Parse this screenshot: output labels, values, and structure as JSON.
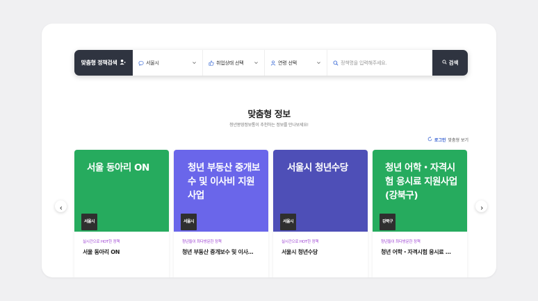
{
  "search": {
    "title": "맞춤형 정책검색",
    "region": "서울시",
    "job_status": "취업상태 선택",
    "age": "연령 선택",
    "placeholder": "정책명을 입력해주세요.",
    "button": "검색"
  },
  "section": {
    "title": "맞춤형 정보",
    "subtitle": "청년몽땅정보통이 추천하는 정보를 만나보세요!",
    "login_emphasis": "로그인",
    "login_rest": "맞춤형 보기"
  },
  "cards": [
    {
      "thumb_title": "서울 동아리 ON",
      "badge": "서울시",
      "category": "실시간으로 HOT한 정책",
      "name": "서울 동아리 ON",
      "color": "#26ab5e"
    },
    {
      "thumb_title": "청년 부동산 중개보수 및 이사비 지원사업",
      "badge": "서울시",
      "category": "청년들이 최다방문한 정책",
      "name": "청년 부동산 중개보수 및 이사…",
      "color": "#6a66ea"
    },
    {
      "thumb_title": "서울시 청년수당",
      "badge": "서울시",
      "category": "실시간으로 HOT한 정책",
      "name": "서울시 청년수당",
      "color": "#4e4fb7"
    },
    {
      "thumb_title": "청년 어학・자격시험 응시료 지원사업(강북구)",
      "badge": "강북구",
      "category": "청년들이 최다방문한 정책",
      "name": "청년 어학・자격시험 응시료 …",
      "color": "#26ab5e"
    }
  ],
  "nav": {
    "prev": "‹",
    "next": "›"
  }
}
